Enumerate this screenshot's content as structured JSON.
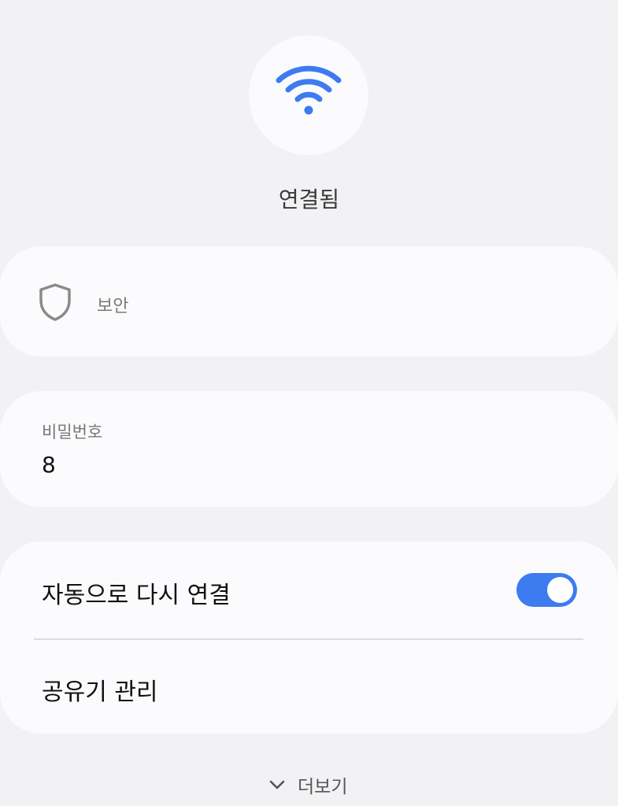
{
  "status": {
    "connection_label": "연결됨",
    "icon": "wifi-icon",
    "accent_color": "#3e7bf0"
  },
  "security": {
    "icon": "shield-icon",
    "label": "보안"
  },
  "password": {
    "label": "비밀번호",
    "value": "8"
  },
  "settings": {
    "auto_reconnect_label": "자동으로 다시 연결",
    "auto_reconnect_enabled": true,
    "router_manage_label": "공유기 관리"
  },
  "more": {
    "icon": "chevron-down-icon",
    "label": "더보기"
  }
}
